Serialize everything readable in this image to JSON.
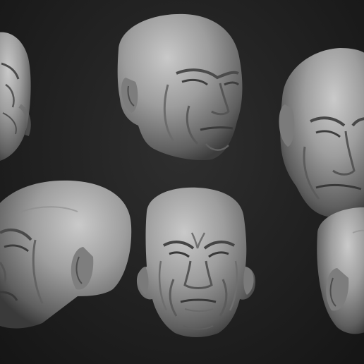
{
  "scene": {
    "background_color": "#1e1e1e",
    "material_color": "#9a9a9a",
    "heads": [
      {
        "id": "head-1",
        "view": "profile-left-cropped"
      },
      {
        "id": "head-2",
        "view": "three-quarter-right"
      },
      {
        "id": "head-3",
        "view": "three-quarter-front-cropped"
      },
      {
        "id": "head-4",
        "view": "profile-left"
      },
      {
        "id": "head-5",
        "view": "front"
      },
      {
        "id": "head-6",
        "view": "side-cropped"
      }
    ]
  }
}
